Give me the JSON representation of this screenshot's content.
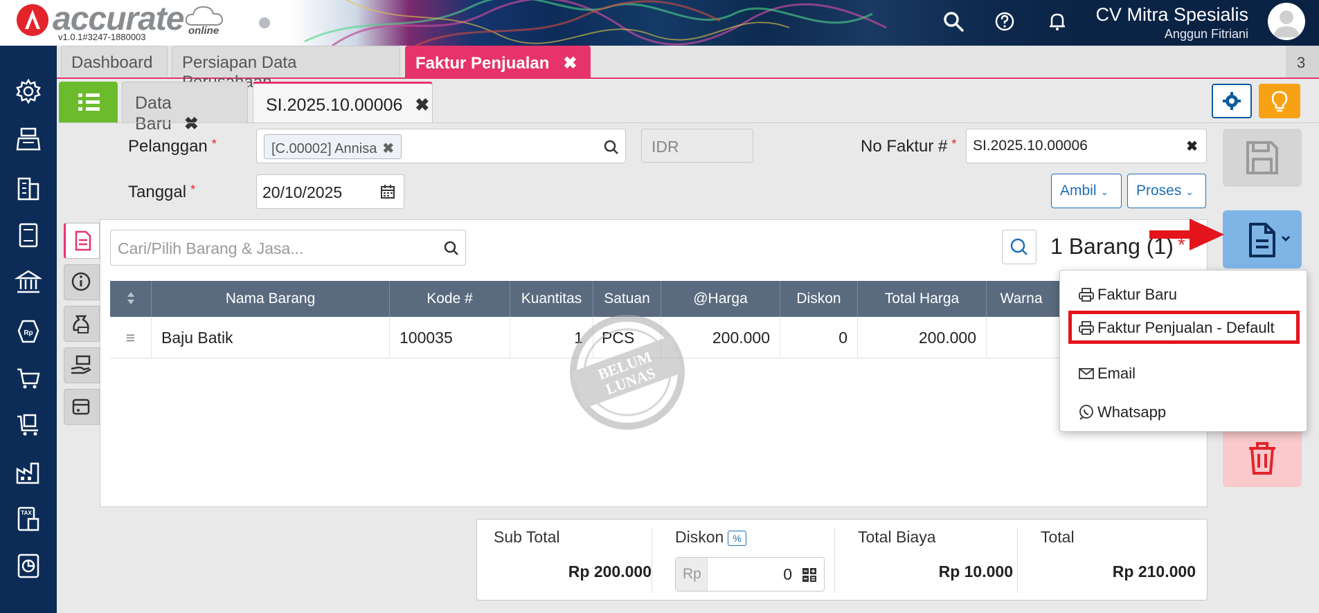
{
  "header": {
    "logo_text": "accurate",
    "logo_sub": "online",
    "version": "v1.0.1#3247-1880003",
    "company_name": "CV Mitra Spesialis",
    "user_name": "Anggun Fitriani"
  },
  "top_tabs": [
    {
      "label": "Dashboard"
    },
    {
      "label": "Persiapan Data Perusahaan"
    },
    {
      "label": "Faktur Penjualan",
      "close": "✖"
    }
  ],
  "tab_count": "3",
  "sub_tabs": [
    {
      "label": "Data Baru",
      "close": "✖"
    },
    {
      "label": "SI.2025.10.00006",
      "close": "✖"
    }
  ],
  "form": {
    "customer_label": "Pelanggan",
    "customer_value": "[C.00002] Annisa",
    "currency": "IDR",
    "date_label": "Tanggal",
    "date_value": "20/10/2025",
    "invoice_no_label": "No Faktur #",
    "invoice_no_value": "SI.2025.10.00006",
    "ambil_label": "Ambil",
    "proses_label": "Proses",
    "required_mark": "*"
  },
  "items": {
    "search_placeholder": "Cari/Pilih Barang & Jasa...",
    "count_label": "1 Barang (1)",
    "columns": [
      "Nama Barang",
      "Kode #",
      "Kuantitas",
      "Satuan",
      "@Harga",
      "Diskon",
      "Total Harga",
      "Warna"
    ],
    "rows": [
      {
        "nama": "Baju Batik",
        "kode": "100035",
        "kuantitas": "1",
        "satuan": "PCS",
        "harga": "200.000",
        "diskon": "0",
        "total": "200.000"
      }
    ],
    "stamp_line1": "BELUM",
    "stamp_line2": "LUNAS"
  },
  "print_menu": [
    {
      "label": "Faktur Baru",
      "icon": "printer-icon"
    },
    {
      "label": "Faktur Penjualan - Default",
      "icon": "printer-icon"
    },
    {
      "label": "Email",
      "icon": "mail-icon"
    },
    {
      "label": "Whatsapp",
      "icon": "whatsapp-icon"
    }
  ],
  "totals": {
    "subtotal_label": "Sub Total",
    "subtotal_value": "Rp 200.000",
    "discount_label": "Diskon",
    "discount_pct": "%",
    "discount_prefix": "Rp",
    "discount_value": "0",
    "biaya_label": "Total Biaya",
    "biaya_value": "Rp 10.000",
    "total_label": "Total",
    "total_value": "Rp 210.000"
  },
  "colors": {
    "accent_pink": "#e7336b",
    "sidebar_navy": "#0c2c57",
    "green": "#6cbb2d",
    "highlight_red": "#e3141c"
  }
}
